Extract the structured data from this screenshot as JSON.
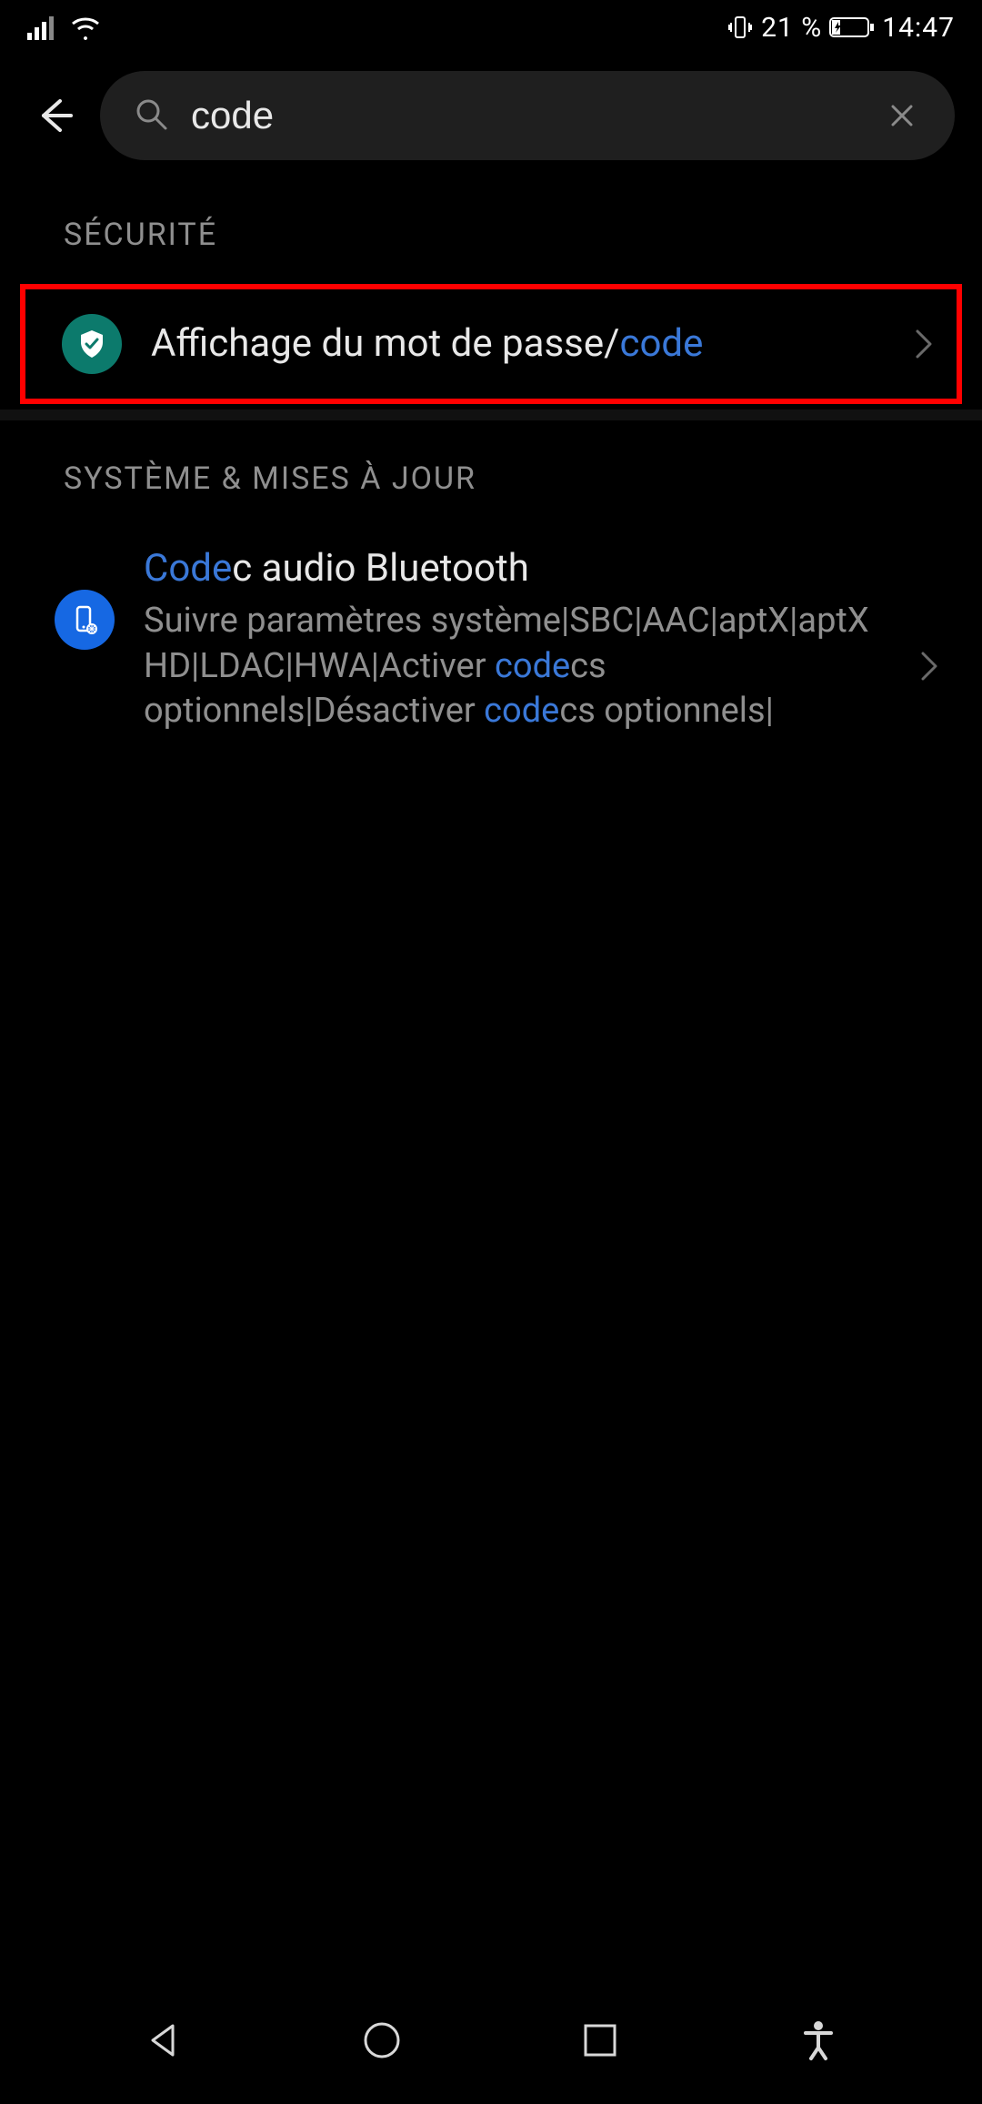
{
  "status": {
    "battery_percent": "21 %",
    "time": "14:47"
  },
  "search": {
    "value": "code",
    "placeholder": ""
  },
  "sections": {
    "security": {
      "heading": "SÉCURITÉ",
      "item1": {
        "title_prefix": "Affichage du mot de passe/",
        "title_highlight": "code"
      }
    },
    "system": {
      "heading": "SYSTÈME & MISES À JOUR",
      "item1": {
        "title_hl": "Code",
        "title_rest": "c audio Bluetooth",
        "sub_a": "Suivre paramètres système|SBC|AAC|aptX|aptX HD|LDAC|HWA|Activer ",
        "sub_hl1": "code",
        "sub_b": "cs optionnels|Désactiver ",
        "sub_hl2": "code",
        "sub_c": "cs optionnels|"
      }
    }
  },
  "icons": {
    "back": "back-arrow-icon",
    "search": "search-icon",
    "clear": "close-icon",
    "shield": "shield-check-icon",
    "phone": "phone-gear-icon",
    "chevron": "chevron-right-icon",
    "nav_back": "nav-back-icon",
    "nav_home": "nav-home-icon",
    "nav_recent": "nav-recent-icon",
    "nav_accessibility": "accessibility-icon"
  }
}
